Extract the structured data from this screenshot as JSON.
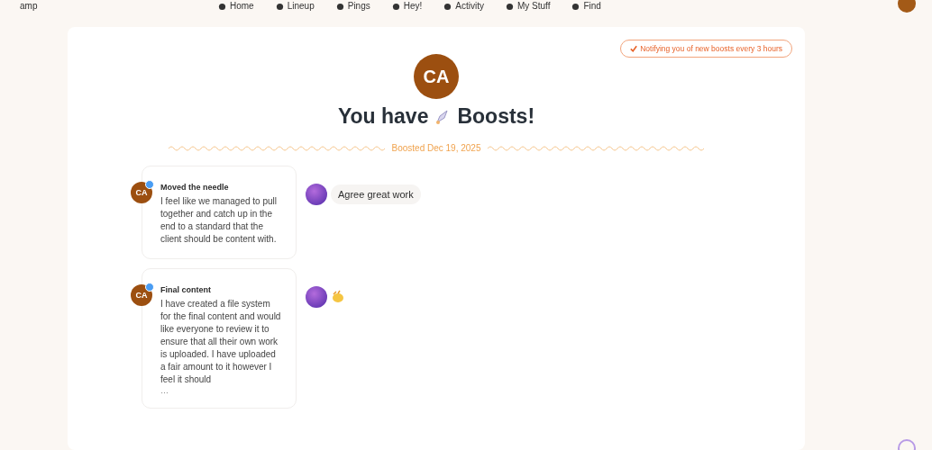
{
  "nav": {
    "brand": "amp",
    "items": [
      {
        "label": "Home"
      },
      {
        "label": "Lineup"
      },
      {
        "label": "Pings"
      },
      {
        "label": "Hey!"
      },
      {
        "label": "Activity"
      },
      {
        "label": "My Stuff"
      },
      {
        "label": "Find"
      }
    ]
  },
  "notice": "Notifying you of new boosts every 3 hours",
  "avatar": "CA",
  "heading": {
    "before": "You have",
    "after": "Boosts!"
  },
  "date": "Boosted Dec 19, 2025",
  "boosts": [
    {
      "avatar": "CA",
      "title": "Moved the needle",
      "text": "I feel like we managed to pull together and catch up in the end to a standard that the client should be content with.",
      "reactions": [
        {
          "kind": "text",
          "text": "Agree great work"
        }
      ]
    },
    {
      "avatar": "CA",
      "title": "Final content",
      "text": "I have created a file system for the final content and would like everyone to review it to ensure that all their own work is uploaded. I have uploaded a fair amount to it however I feel it should",
      "more": "…",
      "reactions": [
        {
          "kind": "icon"
        }
      ]
    }
  ]
}
